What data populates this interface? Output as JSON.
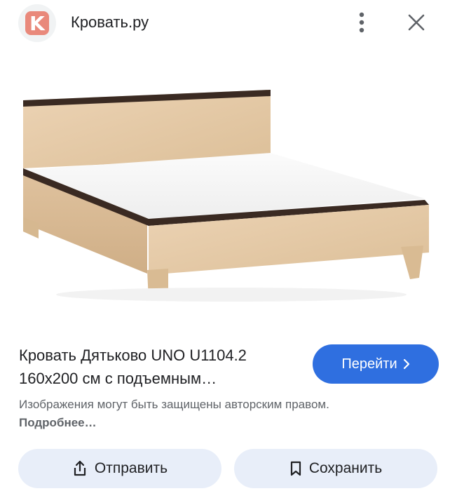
{
  "header": {
    "site_logo_letter": "K",
    "site_name": "Кровать.ру",
    "more_icon": "more-vert-icon",
    "close_icon": "close-icon"
  },
  "product": {
    "title_line1": "Кровать Дятьково UNO U1104.2",
    "title_line2": "160х200 см с подъемным…",
    "goto_label": "Перейти",
    "goto_icon": "chevron-right-icon"
  },
  "notice": {
    "text": "Изображения могут быть защищены авторским правом.",
    "link": "Подробнее…"
  },
  "actions": {
    "share_label": "Отправить",
    "share_icon": "share-icon",
    "save_label": "Сохранить",
    "save_icon": "bookmark-icon"
  },
  "colors": {
    "accent": "#2f6fe0",
    "pill_bg": "#e8eef9",
    "logo": "#e9897b"
  }
}
